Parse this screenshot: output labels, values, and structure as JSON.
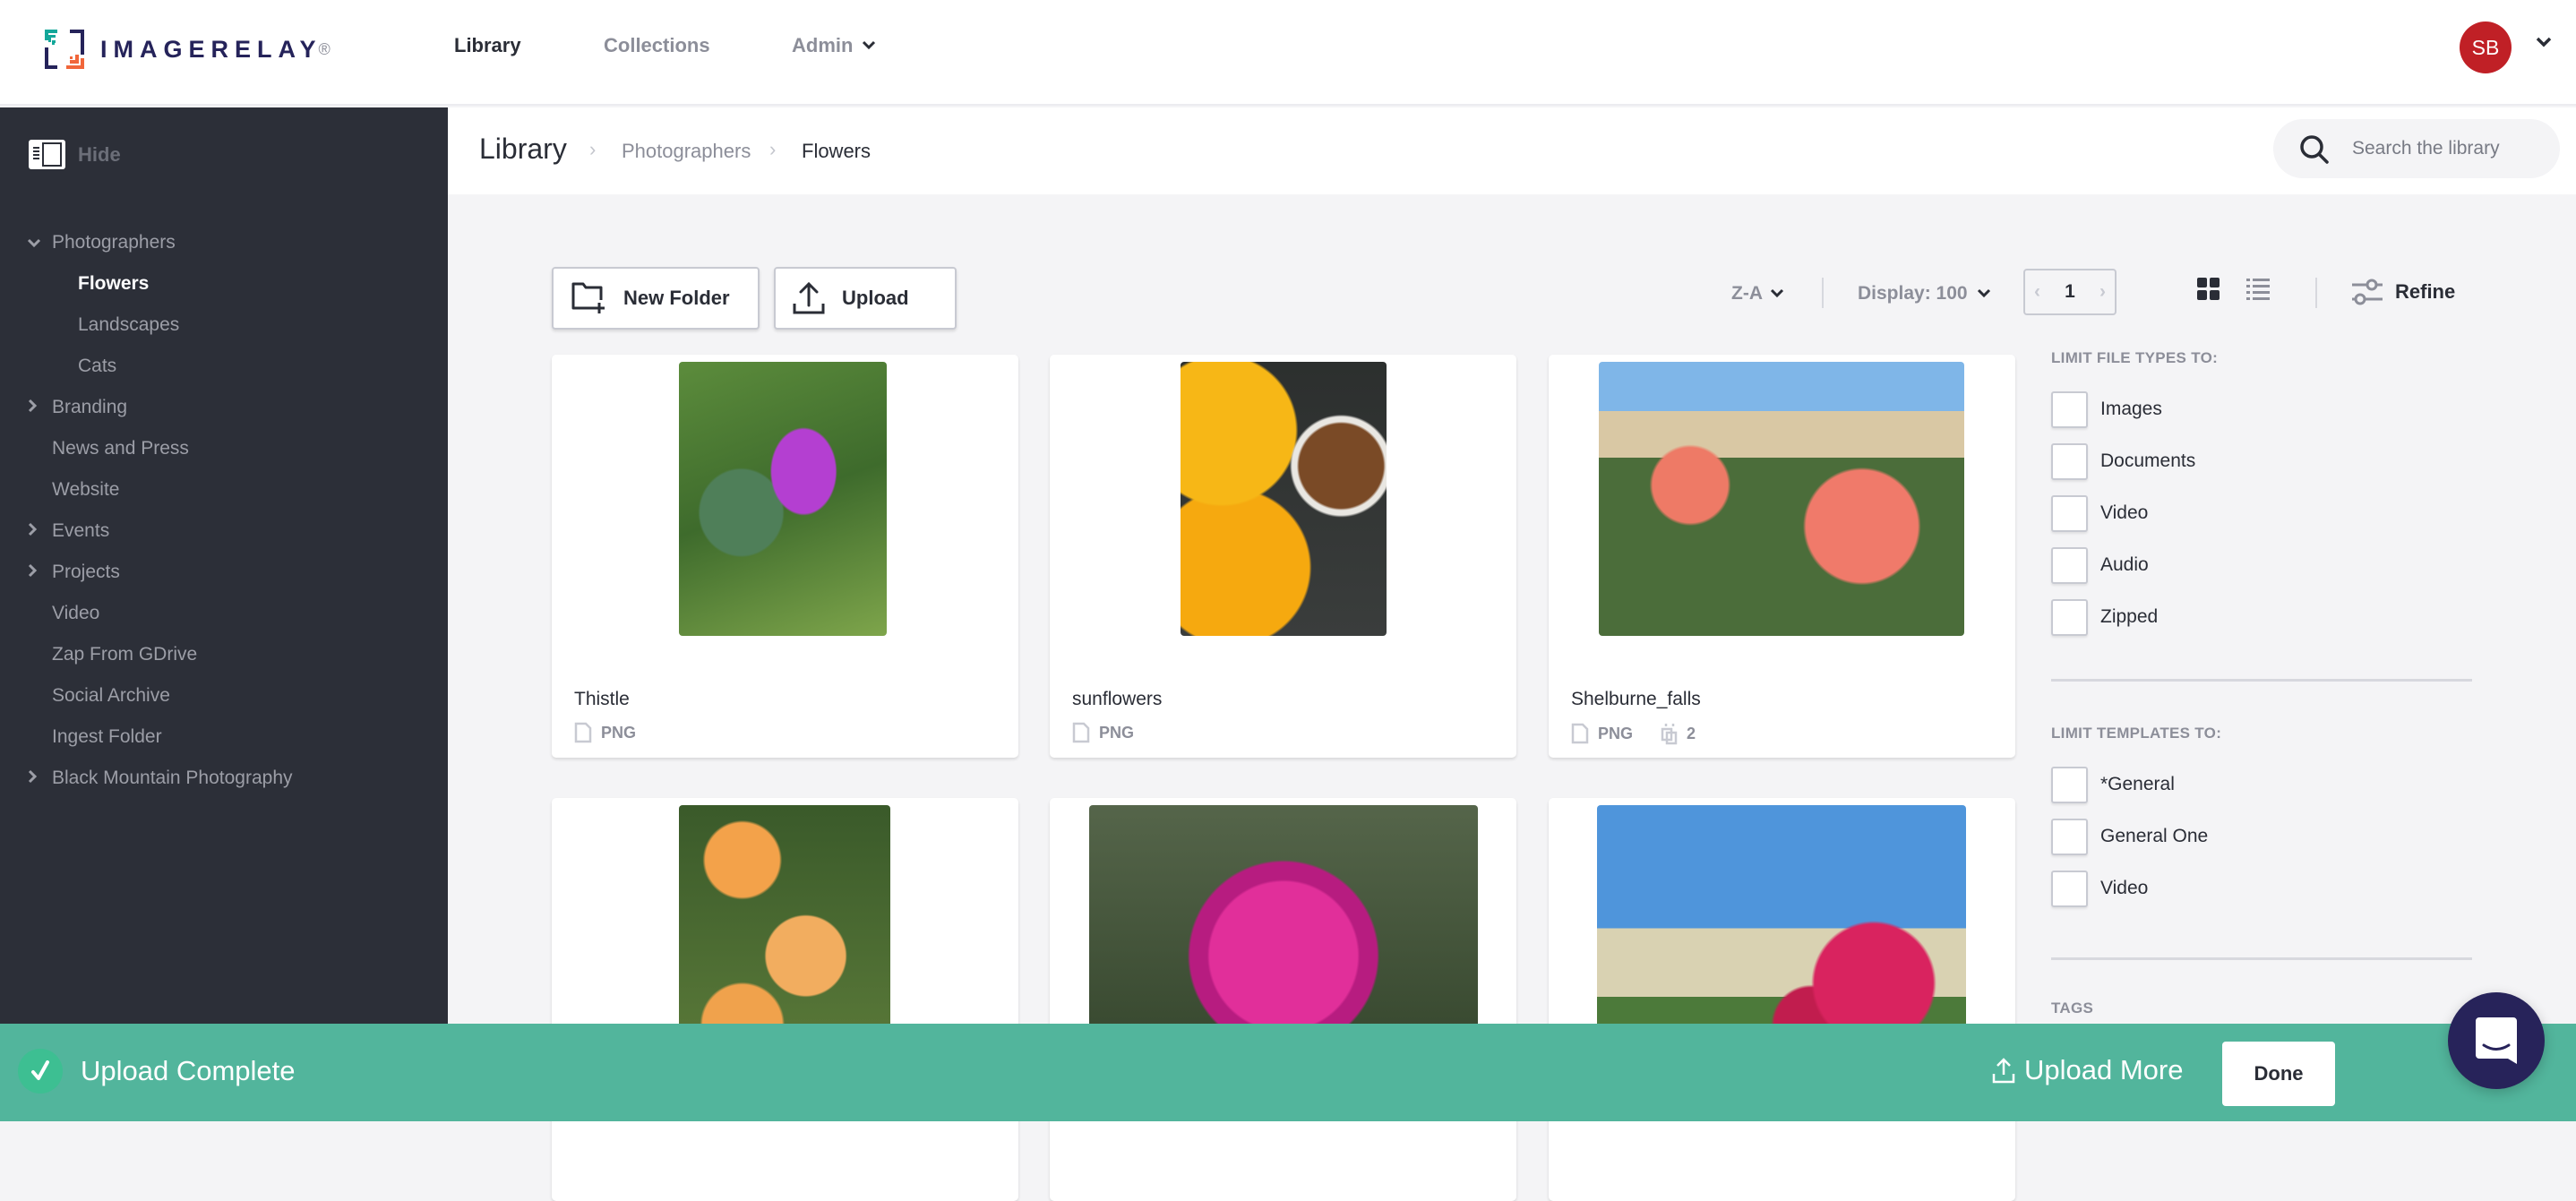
{
  "brand": {
    "name": "IMAGERELAY",
    "reg_mark": "®"
  },
  "topnav": [
    {
      "label": "Library",
      "active": true
    },
    {
      "label": "Collections",
      "active": false
    },
    {
      "label": "Admin",
      "active": false,
      "has_dropdown": true
    }
  ],
  "user": {
    "initials": "SB",
    "avatar_color": "#c02026"
  },
  "sidebar": {
    "hide_label": "Hide",
    "items": [
      {
        "label": "Photographers",
        "toggle": "expanded",
        "level": 0
      },
      {
        "label": "Flowers",
        "level": 1,
        "active": true
      },
      {
        "label": "Landscapes",
        "level": 1
      },
      {
        "label": "Cats",
        "level": 1
      },
      {
        "label": "Branding",
        "toggle": "collapsed",
        "level": 0
      },
      {
        "label": "News and Press",
        "level": 0
      },
      {
        "label": "Website",
        "level": 0
      },
      {
        "label": "Events",
        "toggle": "collapsed",
        "level": 0
      },
      {
        "label": "Projects",
        "toggle": "collapsed",
        "level": 0
      },
      {
        "label": "Video",
        "level": 0
      },
      {
        "label": "Zap From GDrive",
        "level": 0
      },
      {
        "label": "Social Archive",
        "level": 0
      },
      {
        "label": "Ingest Folder",
        "level": 0
      },
      {
        "label": "Black Mountain Photography",
        "toggle": "collapsed",
        "level": 0
      }
    ]
  },
  "breadcrumb": {
    "root": "Library",
    "items": [
      "Photographers",
      "Flowers"
    ]
  },
  "search": {
    "placeholder": "Search the library",
    "value": ""
  },
  "toolbar": {
    "new_folder_label": "New Folder",
    "upload_label": "Upload",
    "sort_label": "Z-A",
    "display_label": "Display: 100",
    "page": "1",
    "view_mode": "grid",
    "refine_label": "Refine"
  },
  "assets": [
    {
      "title": "Thistle",
      "file_type": "PNG"
    },
    {
      "title": "sunflowers",
      "file_type": "PNG"
    },
    {
      "title": "Shelburne_falls",
      "file_type": "PNG",
      "versions": "2"
    },
    {
      "title": "",
      "file_type": ""
    },
    {
      "title": "",
      "file_type": ""
    },
    {
      "title": "",
      "file_type": ""
    }
  ],
  "filters": {
    "file_types": {
      "heading": "LIMIT FILE TYPES TO:",
      "options": [
        {
          "label": "Images",
          "checked": false
        },
        {
          "label": "Documents",
          "checked": false
        },
        {
          "label": "Video",
          "checked": false
        },
        {
          "label": "Audio",
          "checked": false
        },
        {
          "label": "Zipped",
          "checked": false
        }
      ]
    },
    "templates": {
      "heading": "LIMIT TEMPLATES TO:",
      "options": [
        {
          "label": "*General",
          "checked": false
        },
        {
          "label": "General One",
          "checked": false
        },
        {
          "label": "Video",
          "checked": false
        }
      ]
    },
    "tags": {
      "heading": "TAGS"
    }
  },
  "upload_status": {
    "message": "Upload Complete",
    "upload_more_label": "Upload More",
    "done_label": "Done",
    "bar_color": "#52b59c"
  }
}
